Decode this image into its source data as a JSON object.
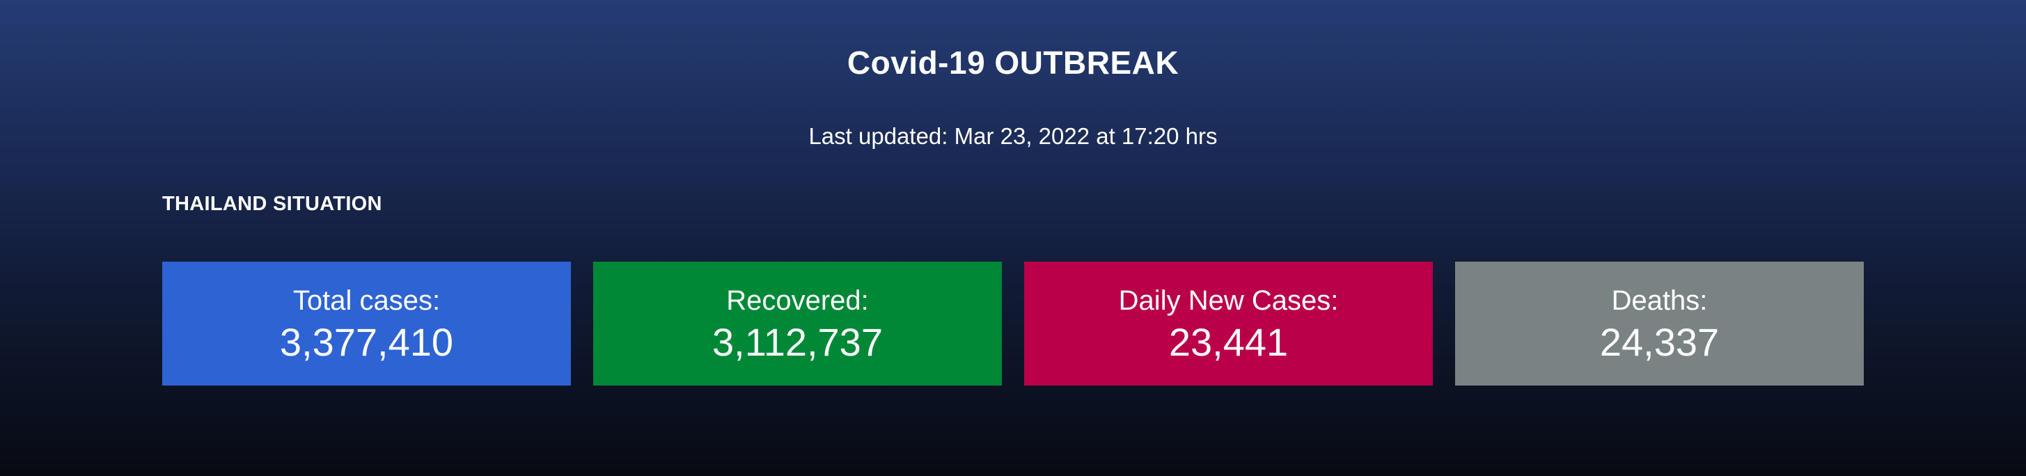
{
  "header": {
    "title": "Covid-19 OUTBREAK",
    "last_updated": "Last updated: Mar 23, 2022 at 17:20 hrs"
  },
  "section": {
    "title": "THAILAND SITUATION"
  },
  "cards": [
    {
      "label": "Total cases:",
      "value": "3,377,410",
      "color": "#2e63d4"
    },
    {
      "label": "Recovered:",
      "value": "3,112,737",
      "color": "#008837"
    },
    {
      "label": "Daily New Cases:",
      "value": "23,441",
      "color": "#ba0048"
    },
    {
      "label": "Deaths:",
      "value": "24,337",
      "color": "#7a8384"
    }
  ]
}
